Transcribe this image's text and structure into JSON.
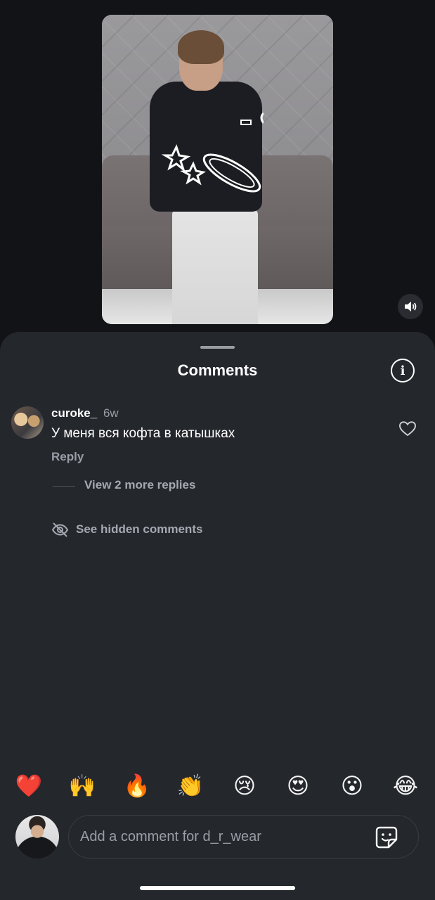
{
  "video": {
    "sound_icon": "speaker-icon"
  },
  "sheet": {
    "title": "Comments",
    "info_icon": "info-icon"
  },
  "comments": [
    {
      "username": "curoke_",
      "time": "6w",
      "text": "У меня вся кофта в катышках",
      "reply_label": "Reply",
      "like_icon": "heart-outline-icon"
    }
  ],
  "replies": {
    "view_more_label": "View 2 more replies"
  },
  "hidden": {
    "label": "See hidden comments",
    "icon": "eye-slash-icon"
  },
  "emojis": [
    "❤️",
    "🙌",
    "🔥",
    "👏",
    "😢",
    "😍",
    "😮",
    "😂"
  ],
  "composer": {
    "placeholder": "Add a comment for d_r_wear",
    "sticker_icon": "sticker-icon"
  },
  "colors": {
    "sheet_bg": "#24272c",
    "background": "#111317",
    "secondary_text": "#9a9ea6"
  }
}
